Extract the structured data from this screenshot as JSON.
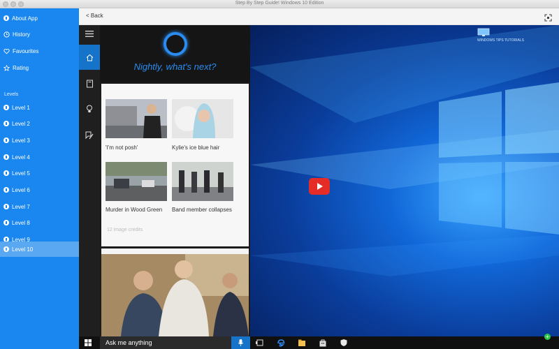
{
  "window": {
    "title": "Step By Step Guide! Windows 10 Edition"
  },
  "sidebar": {
    "top_items": [
      {
        "label": "About App",
        "icon": "info-icon"
      },
      {
        "label": "History",
        "icon": "clock-icon"
      },
      {
        "label": "Favourites",
        "icon": "heart-icon"
      },
      {
        "label": "Rating",
        "icon": "star-icon"
      }
    ],
    "section_label": "Levels",
    "levels": [
      {
        "label": "Level 1"
      },
      {
        "label": "Level 2"
      },
      {
        "label": "Level 3"
      },
      {
        "label": "Level 4"
      },
      {
        "label": "Level 5"
      },
      {
        "label": "Level 6"
      },
      {
        "label": "Level 7"
      },
      {
        "label": "Level 8"
      },
      {
        "label": "Level 9"
      },
      {
        "label": "Level 10",
        "selected": true
      }
    ],
    "accent": "#1a86f0",
    "selected_color": "#5aa8f2"
  },
  "topbar": {
    "back_label": "< Back"
  },
  "video": {
    "cortana_greeting": "Nightly, what's next?",
    "news": [
      {
        "caption": "'I'm not posh'"
      },
      {
        "caption": "Kylie's ice blue hair"
      },
      {
        "caption": "Murder in Wood Green"
      },
      {
        "caption": "Band member collapses"
      }
    ],
    "more_text": "12 image credits",
    "search_placeholder": "Ask me anything",
    "watermark": "WINDOWS  TIPS  TUTORIALS",
    "play_color": "#e52d27"
  }
}
